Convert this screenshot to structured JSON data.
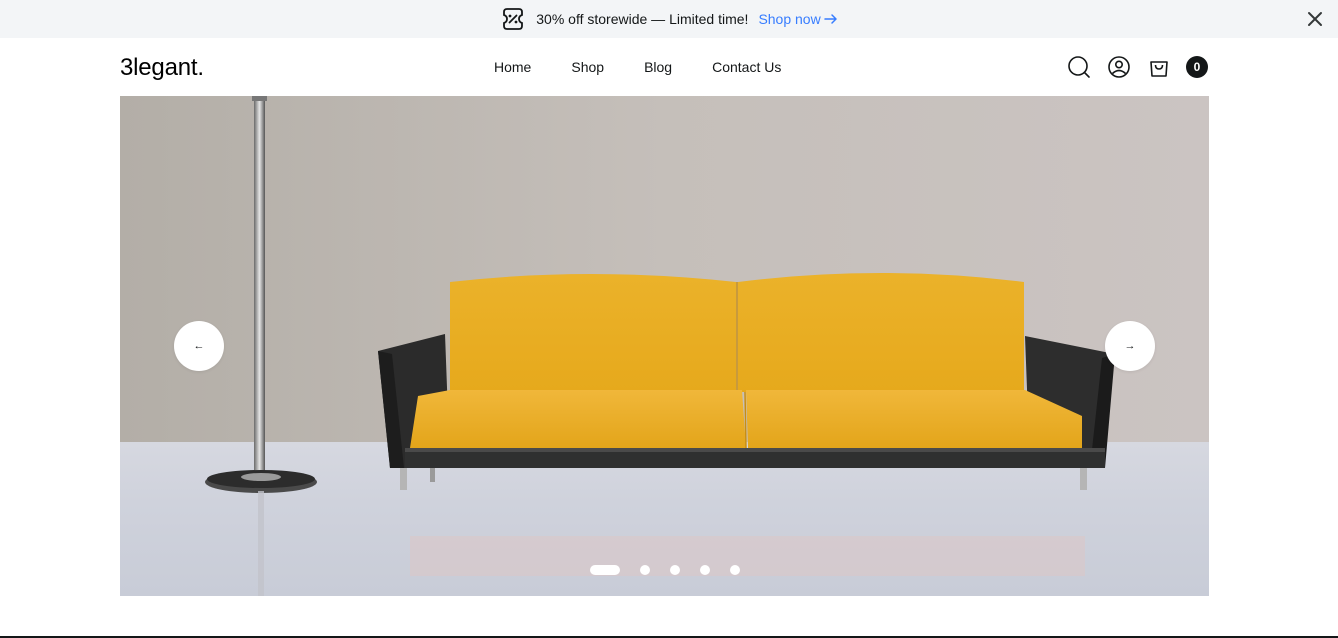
{
  "promo": {
    "text": "30% off storewide — Limited time!",
    "link_label": "Shop now",
    "icon": "ticket-percent-icon",
    "close_icon": "close-icon"
  },
  "header": {
    "logo": "3legant.",
    "nav": [
      "Home",
      "Shop",
      "Blog",
      "Contact Us"
    ],
    "icons": [
      "search-icon",
      "user-icon",
      "shopping-bag-icon"
    ],
    "cart_count": "0"
  },
  "hero": {
    "prev_label": "←",
    "next_label": "→",
    "slides_total": 5,
    "active_slide": 1
  },
  "colors": {
    "accent_link": "#377dff",
    "promo_bg": "#f3f5f7",
    "text": "#141718",
    "sofa": "#e8ab1e"
  }
}
